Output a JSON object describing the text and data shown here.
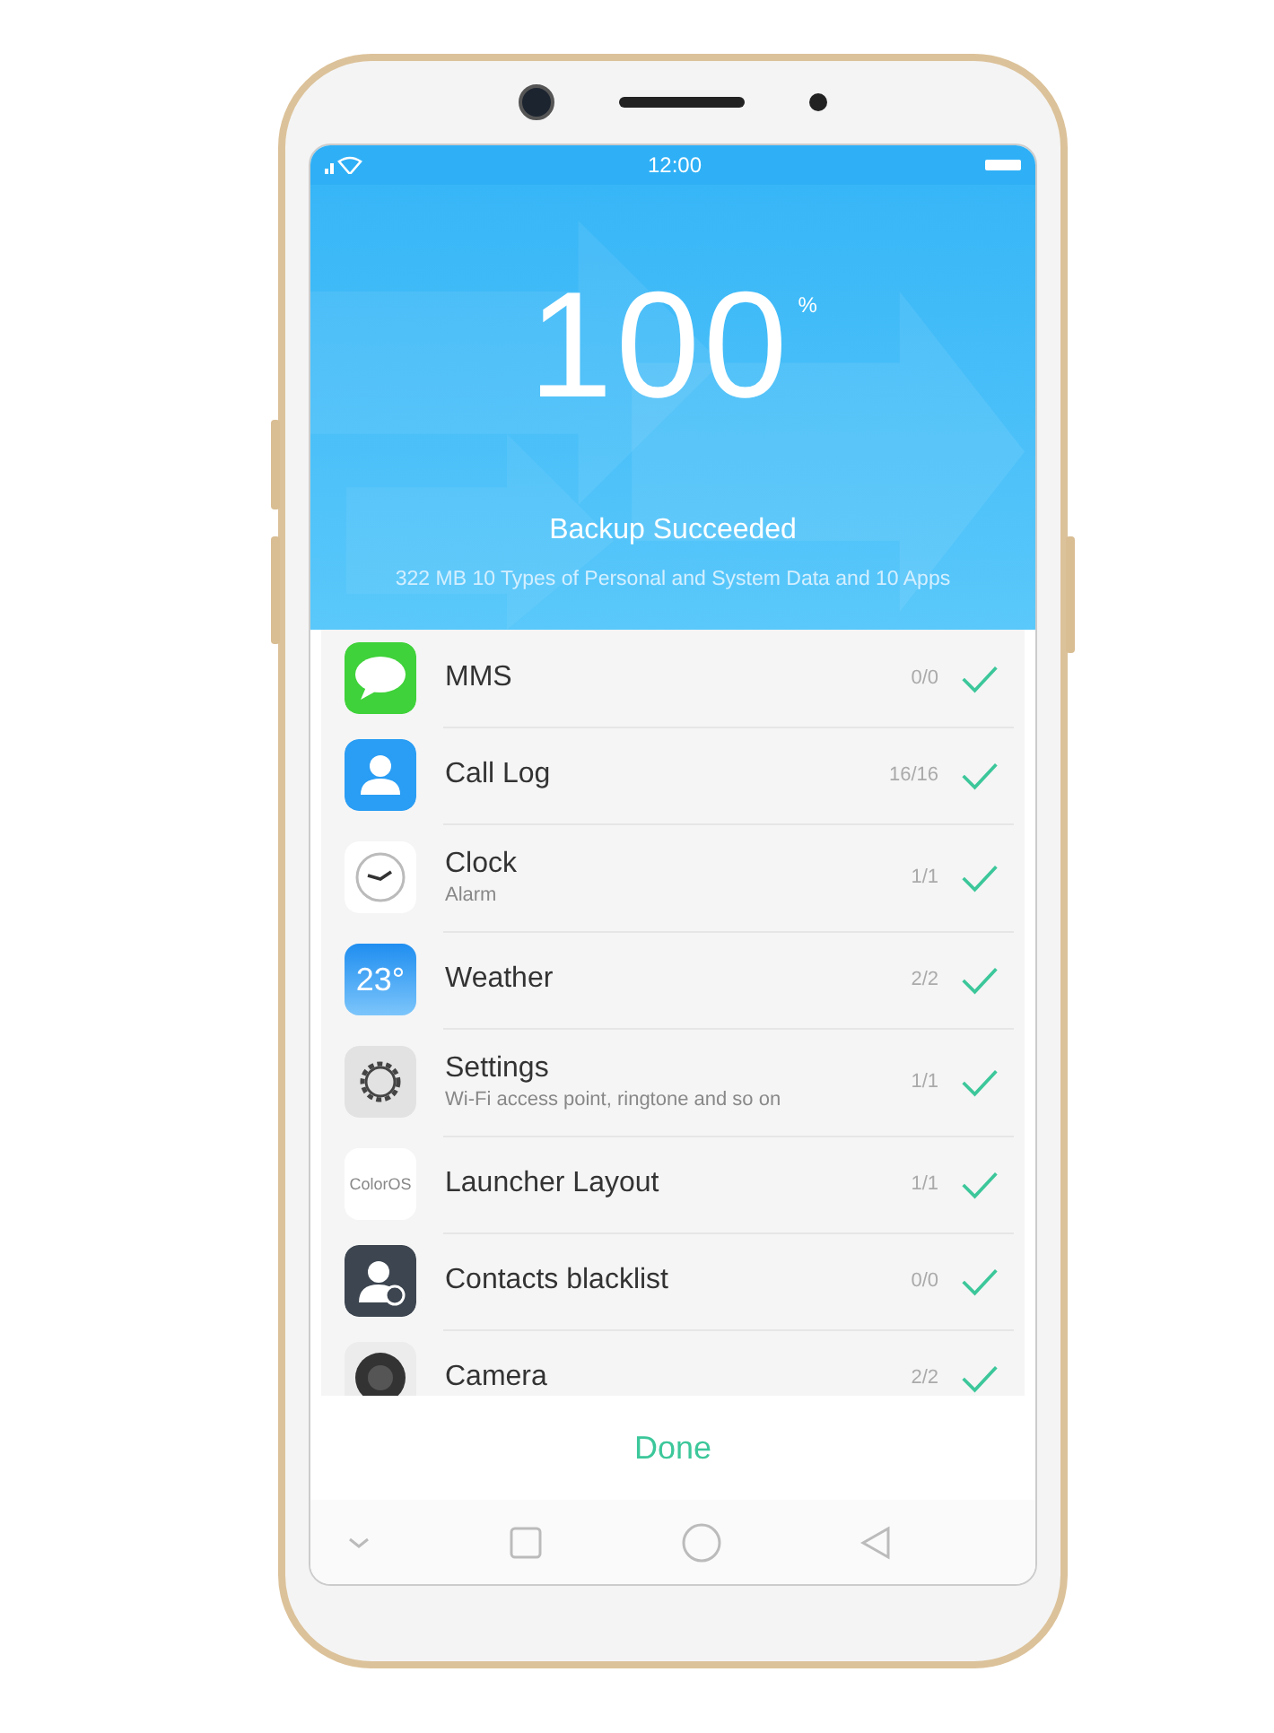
{
  "status_bar": {
    "time": "12:00"
  },
  "header": {
    "percent": "100",
    "percent_sign": "%",
    "title": "Backup Succeeded",
    "subtitle": "322 MB 10 Types of Personal and System Data and 10 Apps"
  },
  "items": [
    {
      "kind": "message",
      "name": "MMS",
      "count": "0/0",
      "checked": true
    },
    {
      "kind": "contact",
      "name": "Call Log",
      "count": "16/16",
      "checked": true
    },
    {
      "kind": "clock",
      "name": "Clock",
      "detail": "Alarm",
      "count": "1/1",
      "checked": true
    },
    {
      "kind": "weather",
      "icon_text": "23°",
      "name": "Weather",
      "count": "2/2",
      "checked": true
    },
    {
      "kind": "gear",
      "name": "Settings",
      "detail": "Wi-Fi access point, ringtone and so on",
      "count": "1/1",
      "checked": true
    },
    {
      "kind": "logo",
      "icon_text": "ColorOS",
      "name": "Launcher Layout",
      "count": "1/1",
      "checked": true
    },
    {
      "kind": "blocked",
      "name": "Contacts blacklist",
      "count": "0/0",
      "checked": true
    },
    {
      "kind": "camera",
      "name": "Camera",
      "count": "2/2",
      "checked": true
    }
  ],
  "done_button": "Done"
}
